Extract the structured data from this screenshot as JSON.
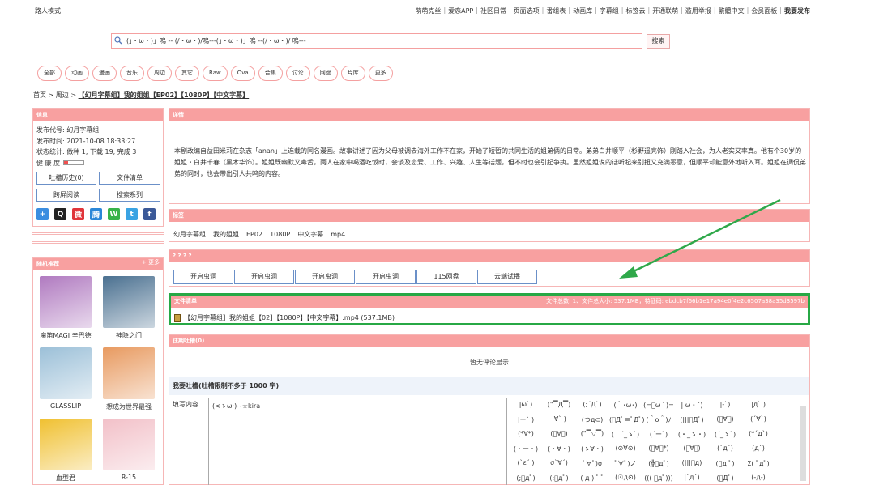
{
  "topbar": {
    "guest": "路人模式",
    "links": [
      "萌萌克丝",
      "爱恋APP",
      "社区日常",
      "页面选项",
      "番组表",
      "动画库",
      "字幕组",
      "标签云",
      "开通联萌",
      "滥用举报",
      "繁體中文",
      "会员面板",
      "我要发布"
    ]
  },
  "search": {
    "value": "(」・ω・)」嗚 -- (/・ω・)/嗚---(」・ω・)」嗚 --(/・ω・)/ 嗚---",
    "button": "搜索"
  },
  "categories": [
    "全部",
    "动画",
    "漫画",
    "音乐",
    "周边",
    "其它",
    "Raw",
    "Ova",
    "合集",
    "讨论",
    "网盘",
    "片库",
    "更多"
  ],
  "breadcrumb": {
    "home": "首页",
    "section": "周边",
    "title": "【幻月字幕组】我的姐姐【EP02】【1080P】【中文字幕】"
  },
  "info": {
    "title": "信息",
    "code": "发布代号: 幻月字幕组",
    "time": "发布时间: 2021-10-08 18:33:27",
    "stats": "状态统计: 做种 1, 下载 19, 完成 3",
    "health_label": "健 康 度",
    "health": 0.2,
    "btn_history": "吐槽历史(0)",
    "btn_files": "文件清单",
    "btn_screen": "跨屏阅读",
    "btn_series": "搜索系列"
  },
  "share_icons": [
    {
      "name": "plus-icon",
      "glyph": "+",
      "color": "#3b8de0"
    },
    {
      "name": "qq-icon",
      "glyph": "Q",
      "color": "#222222"
    },
    {
      "name": "weibo-icon",
      "glyph": "微",
      "color": "#e0353a"
    },
    {
      "name": "tencent-weibo-icon",
      "glyph": "腾",
      "color": "#2a87d8"
    },
    {
      "name": "wechat-icon",
      "glyph": "W",
      "color": "#37b34a"
    },
    {
      "name": "twitter-icon",
      "glyph": "t",
      "color": "#3aa3e3"
    },
    {
      "name": "facebook-icon",
      "glyph": "f",
      "color": "#3b5998"
    }
  ],
  "recommend": {
    "title": "随机推荐",
    "more": "+ 更多",
    "items": [
      {
        "title": "魔笛MAGI 辛巴德",
        "color": "#b07ac0"
      },
      {
        "title": "神隐之门",
        "color": "#4a7090"
      },
      {
        "title": "GLASSLIP",
        "color": "#9cc0d8"
      },
      {
        "title": "想成为世界最强",
        "color": "#e89a60"
      },
      {
        "title": "血型君",
        "color": "#f0c030"
      },
      {
        "title": "R-15",
        "color": "#f2c0c8"
      }
    ]
  },
  "detail": {
    "title": "详情",
    "text": "本剧改编自益田米莉在杂志「anan」上连载的同名漫画。故事讲述了因为父母被调去海外工作不在家，开始了短暂的共同生活的姐弟俩的日常。弟弟白井顺平（杉野遥亮饰）刚踏入社会，为人老实又率真。他有个30岁的姐姐・白井千春（黑木华饰）。姐姐既幽默又毒舌，两人在家中喝酒吃饭时，会谈及恋爱、工作、兴趣、人生等话题，但不时也会引起争执。虽然姐姐说的话听起来别扭又充满恶意，但顺平却能意外地听入耳。姐姐在调侃弟弟的同时，也会带出引人共鸣的内容。"
  },
  "tags": {
    "title": "标签",
    "items": [
      "幻月字幕组",
      "我的姐姐",
      "EP02",
      "1080P",
      "中文字幕",
      "mp4"
    ]
  },
  "mirrors": {
    "title": "? ? ? ?",
    "buttons": [
      "开启虫洞",
      "开启虫洞",
      "开启虫洞",
      "开启虫洞",
      "115网盘",
      "云端试播"
    ]
  },
  "files": {
    "title": "文件清单",
    "stats": "文件总数: 1、文件总大小: 537.1MB，特征码: ebdcb7f66b1e17a94e0f4e2c6507a38a35d3597b",
    "file": "【幻月字幕组】我的姐姐【02】【1080P】【中文字幕】.mp4",
    "size": "(537.1MB)"
  },
  "comments": {
    "title": "往期吐槽(0)",
    "empty": "暂无评论显示",
    "write": "我要吐槽(吐槽限制不多于 1000 字)",
    "label": "填写内容",
    "value": "(<ゝω·)~☆kira"
  },
  "emoji": [
    [
      "|ω`)",
      "(\"▔Д▔)",
      "(;´Д`)",
      "(｀･ω･)",
      "(=ﾟω ﾟ)=",
      "| ω・´)",
      "|-`)",
      "|д` )"
    ],
    [
      "|ー` )",
      "|∀` )",
      "(つд⊂)",
      "(ﾟДﾟ≡ﾟДﾟ)",
      "(＾o＾)ﾉ",
      "(|||ﾟДﾟ)",
      "(ﾟ∀ﾟ)",
      "(´∀`)"
    ],
    [
      "(*∀*)",
      "(ﾟ∀ﾟ)",
      "(\"▔▽▔)",
      "(　´_ゝ`)",
      "(´ー`)",
      "(・_ゝ・)",
      "(´_ゝ`)",
      "(*´д`)"
    ],
    [
      "(・ー・)",
      "(・∀・)",
      "(ゝ∀・)",
      "(⊙∀⊙)",
      "(ﾟ∀ﾟ*)",
      "(ﾟ∀。)",
      "(`д´)",
      "(д`)"
    ],
    [
      "(`ε´ )",
      "σ`∀´)",
      "ﾟ∀ﾟ)σ",
      "ﾟ∀ﾟ)ノ",
      "(╬ﾟдﾟ)",
      "(|||ﾟд)",
      "(ﾟд ﾟ)",
      "Σ( ﾟдﾟ)"
    ],
    [
      "(;ﾟдﾟ)",
      "(;ﾟдﾟ)",
      "( д ) ﾟ ﾟ",
      "(☉д⊙)",
      "((( ﾟдﾟ)))",
      "|`д´)",
      "(ﾟДﾟ)",
      "(-д-)"
    ]
  ]
}
